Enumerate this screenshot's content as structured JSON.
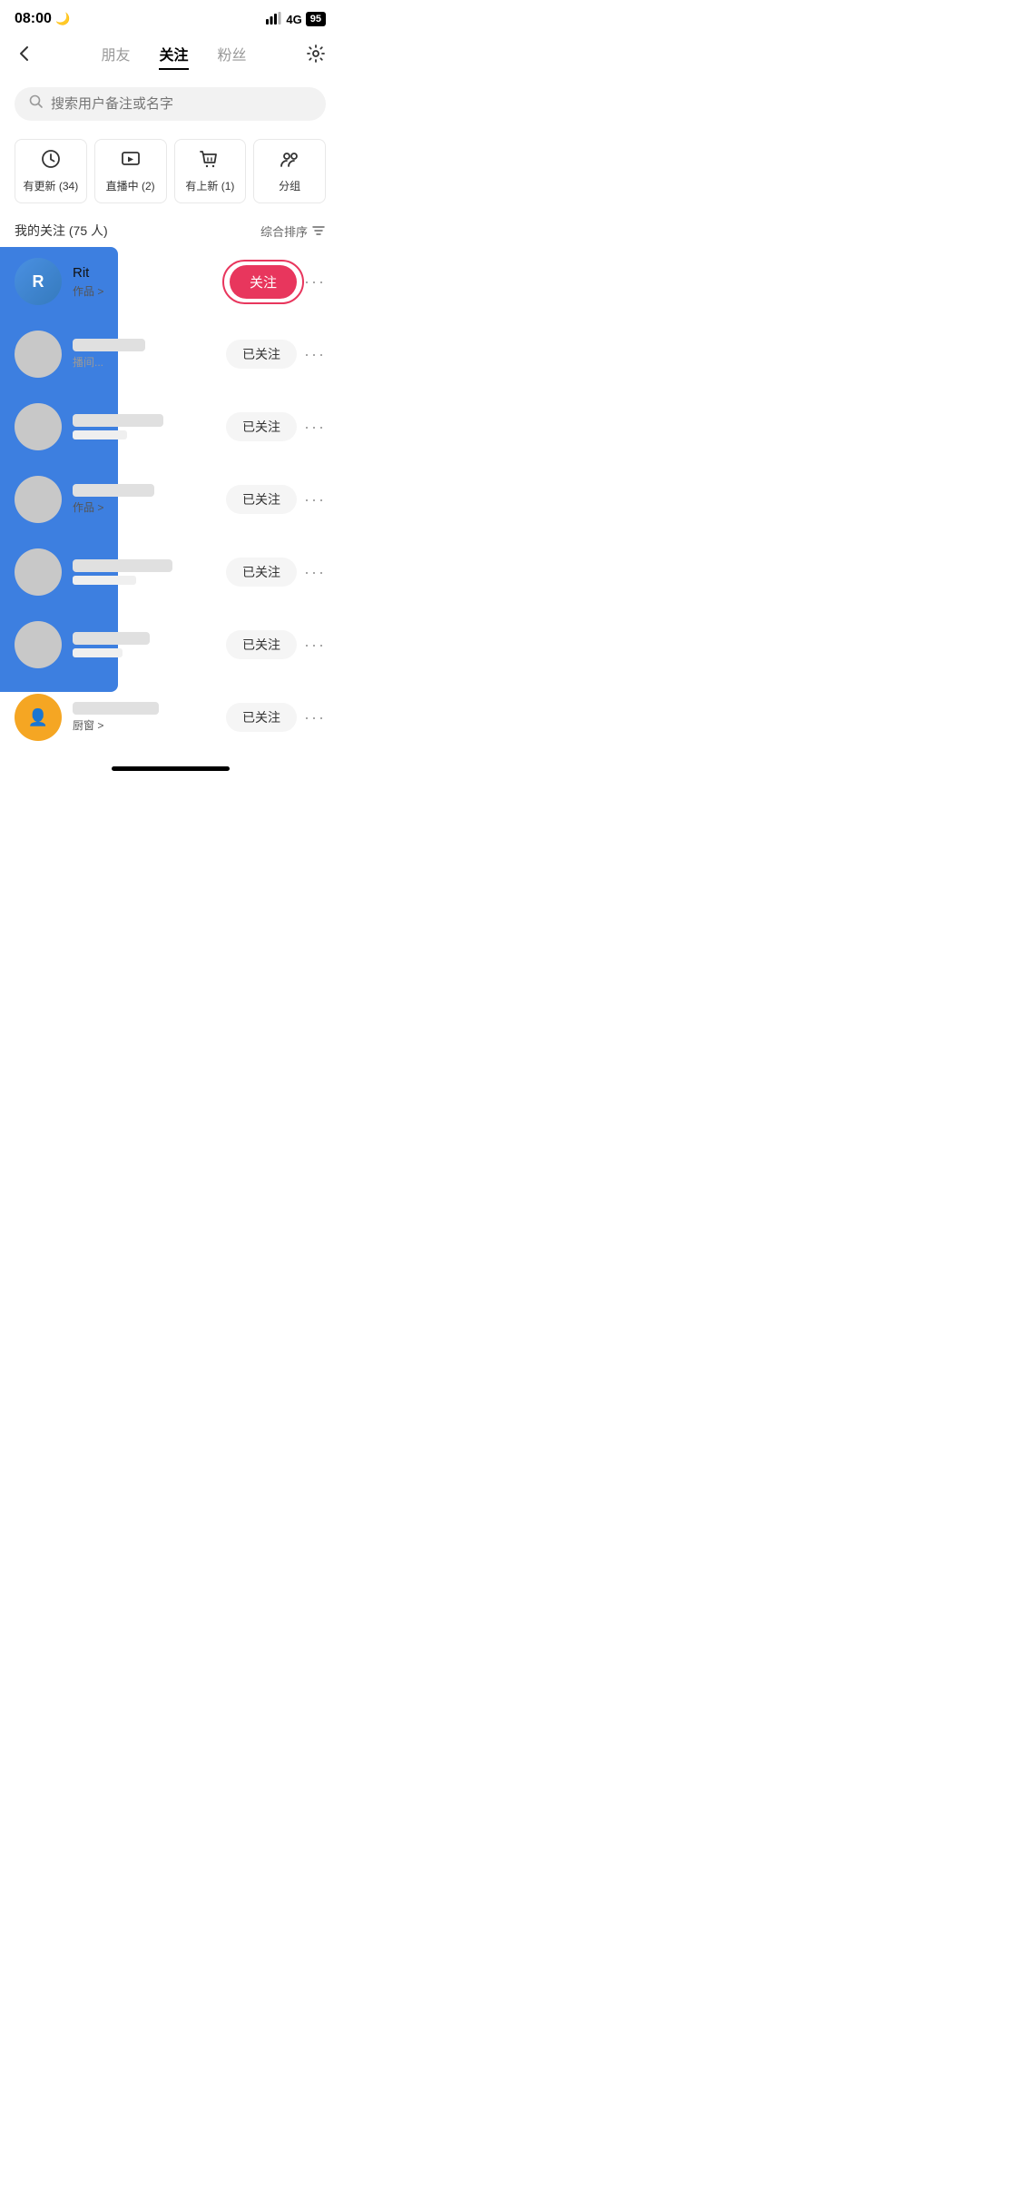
{
  "statusBar": {
    "time": "08:00",
    "moonIcon": "🌙",
    "signal": "📶",
    "network": "4G",
    "battery": "95"
  },
  "nav": {
    "tabs": [
      {
        "label": "朋友",
        "active": false
      },
      {
        "label": "关注",
        "active": true
      },
      {
        "label": "粉丝",
        "active": false
      }
    ],
    "settingsIcon": "⚙"
  },
  "search": {
    "placeholder": "搜索用户备注或名字"
  },
  "filters": [
    {
      "icon": "🕐",
      "label": "有更新 (34)"
    },
    {
      "icon": "📺",
      "label": "直播中 (2)"
    },
    {
      "icon": "🛍",
      "label": "有上新 (1)"
    },
    {
      "icon": "👥",
      "label": "分组"
    }
  ],
  "followsHeader": {
    "title": "我的关注 (75 人)",
    "sort": "综合排序"
  },
  "users": [
    {
      "name": "Rit",
      "sub": "作品 >",
      "avatarColor": "blue",
      "followed": false,
      "followLabel": "关注",
      "highlight": true
    },
    {
      "name": "",
      "sub": "播间...",
      "avatarColor": "gray",
      "followed": true,
      "followLabel": "已关注",
      "highlight": false
    },
    {
      "name": "",
      "sub": "",
      "avatarColor": "gray",
      "followed": true,
      "followLabel": "已关注",
      "highlight": false
    },
    {
      "name": "",
      "sub": "作品 >",
      "avatarColor": "gray",
      "followed": true,
      "followLabel": "已关注",
      "highlight": false
    },
    {
      "name": "",
      "sub": "",
      "avatarColor": "gray",
      "followed": true,
      "followLabel": "已关注",
      "highlight": false
    },
    {
      "name": "",
      "sub": "",
      "avatarColor": "gray",
      "followed": true,
      "followLabel": "已关注",
      "highlight": false
    },
    {
      "name": "",
      "sub": "厨窗 >",
      "avatarColor": "orange",
      "followed": true,
      "followLabel": "已关注",
      "highlight": false
    }
  ],
  "colors": {
    "accent": "#e8365d",
    "blueOverlay": "#3d7fe0"
  }
}
